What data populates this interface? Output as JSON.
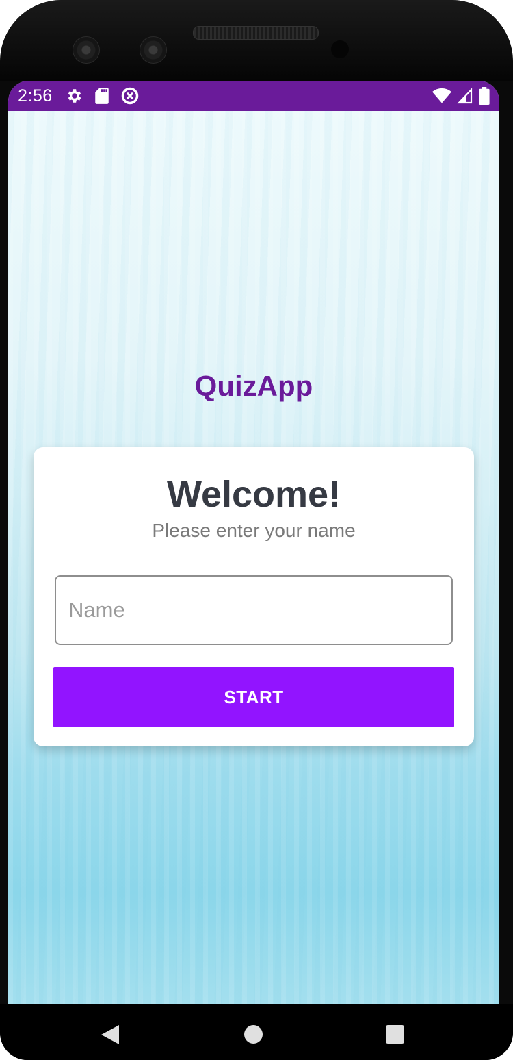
{
  "status_bar": {
    "time": "2:56",
    "background_color": "#6a1b9a",
    "left_icons": [
      "gear-icon",
      "sd-card-icon",
      "data-saver-icon"
    ],
    "right_icons": [
      "wifi-icon",
      "cell-signal-icon",
      "battery-icon"
    ]
  },
  "app": {
    "title": "QuizApp",
    "title_color": "#6a1b9a"
  },
  "card": {
    "heading": "Welcome!",
    "subtitle": "Please enter your name",
    "name_input": {
      "value": "",
      "placeholder": "Name"
    },
    "start_button": {
      "label": "START",
      "color": "#9214ff"
    }
  },
  "nav_bar": {
    "buttons": [
      "back-icon",
      "home-icon",
      "recents-icon"
    ]
  }
}
